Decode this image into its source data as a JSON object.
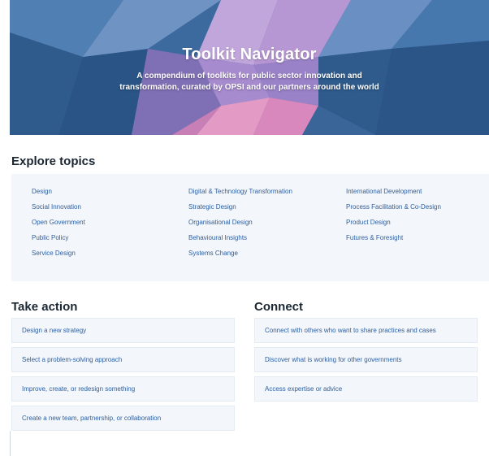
{
  "hero": {
    "title": "Toolkit Navigator",
    "subtitle": "A compendium of toolkits for public sector innovation and transformation, curated by OPSI and our partners around the world",
    "colors": {
      "blue": "#3f6ea3",
      "light_blue": "#5f8fc0",
      "purple": "#b79bd6",
      "pink": "#e7a3c8"
    }
  },
  "explore": {
    "heading": "Explore topics",
    "col1": [
      "Design",
      "Social Innovation",
      "Open Government",
      "Public Policy",
      "Service Design"
    ],
    "col2": [
      "Digital & Technology Transformation",
      "Strategic Design",
      "Organisational Design",
      "Behavioural Insights",
      "Systems Change"
    ],
    "col3": [
      "International Development",
      "Process Facilitation & Co-Design",
      "Product Design",
      "Futures & Foresight"
    ]
  },
  "take_action": {
    "heading": "Take action",
    "items": [
      "Design a new strategy",
      "Select a problem-solving approach",
      "Improve, create, or redesign something",
      "Create a new team, partnership, or collaboration"
    ]
  },
  "connect": {
    "heading": "Connect",
    "items": [
      "Connect with others who want to share practices and cases",
      "Discover what is working for other governments",
      "Access expertise or advice"
    ]
  }
}
